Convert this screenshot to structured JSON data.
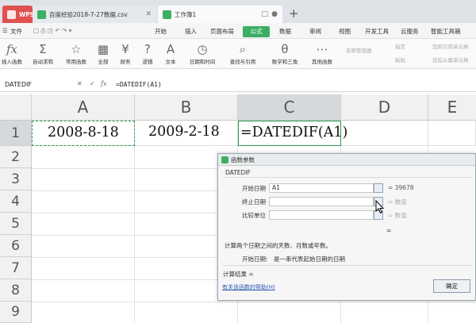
{
  "tabs": [
    {
      "label": "WPS"
    },
    {
      "label": "百度经验2018-7-27数据.csv"
    },
    {
      "label": "工作簿1"
    }
  ],
  "menu": {
    "file": "文件",
    "start": "开始",
    "insert": "插入",
    "page_layout": "页面布局",
    "formulas": "公式",
    "data": "数据",
    "review": "审阅",
    "view": "视图",
    "developer": "开发工具",
    "cloud": "云服务",
    "smart": "智能工具箱"
  },
  "ribbon": {
    "insert_func": "插入函数",
    "autosum": "自动求和",
    "common": "常用函数",
    "all": "全部",
    "finance": "财务",
    "logic": "逻辑",
    "text": "文本",
    "datetime": "日期和时间",
    "lookup": "查找与引用",
    "math": "数学和三角",
    "other": "其他函数",
    "name_mgr": "名称管理器",
    "specify": "指定",
    "paste": "粘贴",
    "trace_prec": "追踪引用单元格",
    "trace_dep": "追踪从属单元格"
  },
  "formula_bar": {
    "name_box": "DATEDIF",
    "fx": "fx",
    "formula": "=DATEDIF(A1)"
  },
  "columns": [
    "A",
    "B",
    "C",
    "D",
    "E"
  ],
  "rows": [
    "1",
    "2",
    "3",
    "4",
    "5",
    "6",
    "7",
    "8",
    "9"
  ],
  "cells": {
    "A1": "2008-8-18",
    "B1": "2009-2-18",
    "C1": "=DATEDIF(A1)"
  },
  "dialog": {
    "title": "函数参数",
    "func_name": "DATEDIF",
    "args": [
      {
        "label": "开始日期",
        "value": "A1",
        "result": "= 39678"
      },
      {
        "label": "终止日期",
        "value": "",
        "result": "= 数值"
      },
      {
        "label": "比较单位",
        "value": "",
        "result": "= 数值"
      }
    ],
    "eq": "=",
    "description": "计算两个日期之间的天数、月数或年数。",
    "arg_desc_label": "开始日期:",
    "arg_desc": "是一串代表起始日期的日期",
    "calc_result": "计算结果 =",
    "help": "有关该函数的帮助(H)",
    "ok": "确定"
  }
}
